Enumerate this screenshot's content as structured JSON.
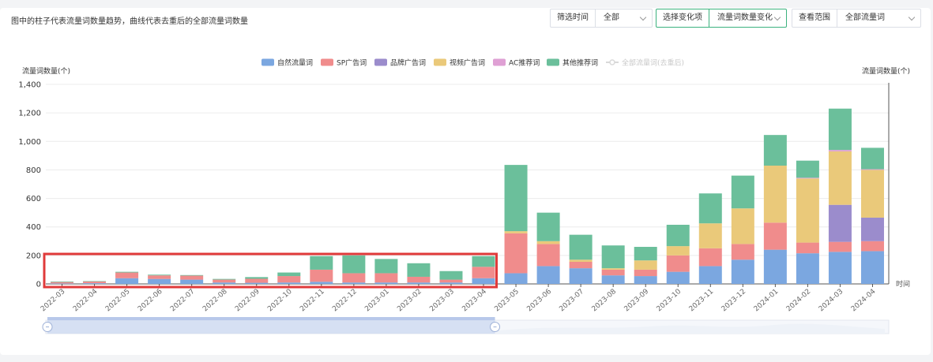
{
  "header": {
    "note": "图中的柱子代表流量词数量趋势，曲线代表去重后的全部流量词数量",
    "filters": [
      {
        "label": "筛选时间",
        "value": "全部"
      },
      {
        "label": "选择变化项",
        "value": "流量词数量变化"
      },
      {
        "label": "查看范围",
        "value": "全部流量词"
      }
    ]
  },
  "chart_data": {
    "type": "bar",
    "stacked": true,
    "ylabel": "流量词数量(个)",
    "y2label": "流量词数量(个)",
    "xlabel": "时间",
    "ylim": [
      0,
      1400
    ],
    "yticks": [
      "0",
      "200",
      "400",
      "600",
      "800",
      "1,000",
      "1,200",
      "1,400"
    ],
    "grid": true,
    "legend_position": "top-center",
    "categories": [
      "2022-03",
      "2022-04",
      "2022-05",
      "2022-06",
      "2022-07",
      "2022-08",
      "2022-09",
      "2022-10",
      "2022-11",
      "2022-12",
      "2023-01",
      "2023-02",
      "2023-03",
      "2023-04",
      "2023-05",
      "2023-06",
      "2023-07",
      "2023-08",
      "2023-09",
      "2023-10",
      "2023-11",
      "2023-12",
      "2024-01",
      "2024-02",
      "2024-03",
      "2024-04"
    ],
    "series": [
      {
        "name": "自然流量词",
        "color": "#7ba7e0",
        "values": [
          3,
          5,
          40,
          35,
          30,
          10,
          8,
          10,
          15,
          10,
          10,
          10,
          10,
          40,
          75,
          125,
          110,
          60,
          55,
          85,
          125,
          170,
          240,
          215,
          225,
          230
        ]
      },
      {
        "name": "SP广告词",
        "color": "#f08c8c",
        "values": [
          10,
          12,
          40,
          25,
          28,
          20,
          28,
          45,
          85,
          65,
          65,
          40,
          20,
          80,
          280,
          155,
          45,
          40,
          45,
          115,
          125,
          110,
          190,
          75,
          70,
          70
        ]
      },
      {
        "name": "品牌广告词",
        "color": "#9b8ccc",
        "values": [
          0,
          0,
          0,
          0,
          0,
          0,
          0,
          0,
          0,
          0,
          0,
          0,
          0,
          0,
          0,
          0,
          0,
          0,
          0,
          0,
          0,
          0,
          0,
          0,
          260,
          165
        ]
      },
      {
        "name": "视频广告词",
        "color": "#eac97a",
        "values": [
          0,
          0,
          0,
          0,
          0,
          0,
          0,
          0,
          0,
          0,
          0,
          0,
          0,
          0,
          15,
          20,
          15,
          10,
          65,
          65,
          175,
          250,
          400,
          450,
          375,
          335
        ]
      },
      {
        "name": "AC推荐词",
        "color": "#dfa0d4",
        "values": [
          0,
          0,
          0,
          0,
          0,
          0,
          0,
          0,
          0,
          0,
          0,
          0,
          0,
          0,
          0,
          0,
          0,
          0,
          0,
          0,
          0,
          0,
          0,
          5,
          10,
          5
        ]
      },
      {
        "name": "其他推荐词",
        "color": "#6bbf9b",
        "values": [
          4,
          3,
          5,
          5,
          4,
          5,
          12,
          25,
          95,
          125,
          100,
          95,
          60,
          75,
          465,
          200,
          175,
          160,
          95,
          150,
          210,
          230,
          215,
          120,
          290,
          150
        ]
      },
      {
        "name": "全部流量词(去重后)",
        "color": "#d9d9d9",
        "values": [],
        "hidden": true
      }
    ],
    "annotation": {
      "type": "highlight-box",
      "color": "#e03a3a",
      "from": "2022-03",
      "to": "2023-04"
    },
    "zoom_slider": {
      "from": "2022-03",
      "to": "2023-04"
    }
  }
}
